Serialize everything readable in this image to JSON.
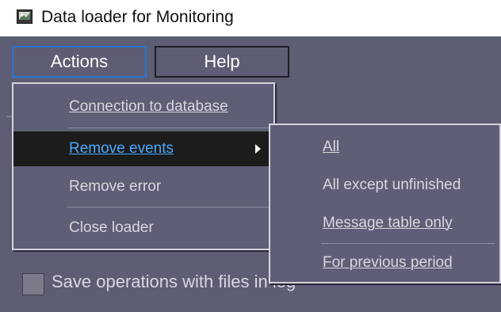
{
  "window": {
    "title": "Data loader for Monitoring",
    "icon": "app-monitor-icon"
  },
  "menubar": {
    "items": [
      {
        "label": "Actions"
      },
      {
        "label": "Help"
      }
    ]
  },
  "actions_menu": {
    "items": [
      {
        "label": "Connection to database"
      },
      {
        "label": "Remove events",
        "submenu": true
      },
      {
        "label": "Remove error"
      },
      {
        "label": "Close loader"
      }
    ]
  },
  "remove_events_submenu": {
    "items": [
      {
        "label": "All"
      },
      {
        "label": "All except unfinished"
      },
      {
        "label": "Message table only"
      },
      {
        "label": "For previous period"
      }
    ]
  },
  "options": {
    "save_operations_label": "Save operations with files in log",
    "save_operations_checked": false
  },
  "colors": {
    "client_bg": "#5d5d74",
    "highlight_bg": "#1c1c1c",
    "highlight_text": "#4aa8ff",
    "focus_border": "#2a74d0"
  }
}
